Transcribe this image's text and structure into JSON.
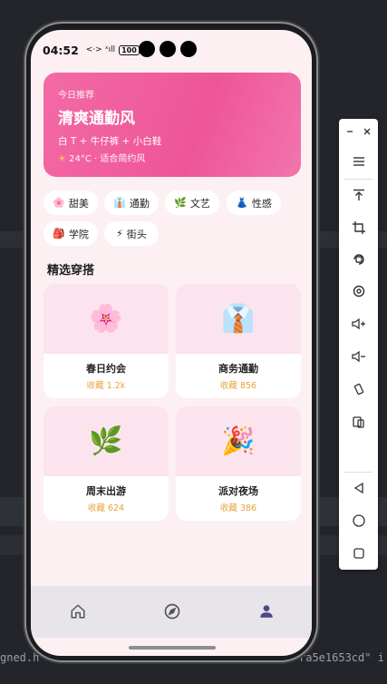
{
  "status_bar": {
    "time": "04:52",
    "indicators": "<·> ˣıll",
    "battery": "100"
  },
  "hero": {
    "kicker": "今日推荐",
    "title": "清爽通勤风",
    "outfit": "白 T + 牛仔裤 + 小白鞋",
    "weather_icon": "☀",
    "weather": "24°C · 适合简约风"
  },
  "chips": [
    {
      "icon": "🌸",
      "label": "甜美"
    },
    {
      "icon": "👔",
      "label": "通勤"
    },
    {
      "icon": "🌿",
      "label": "文艺"
    },
    {
      "icon": "👗",
      "label": "性感"
    },
    {
      "icon": "🎒",
      "label": "学院"
    },
    {
      "icon": "⚡",
      "label": "街头"
    }
  ],
  "section_title": "精选穿搭",
  "cards": [
    {
      "emoji": "🌸",
      "name": "春日约会",
      "favorites": "收藏 1.2k"
    },
    {
      "emoji": "👔",
      "name": "商务通勤",
      "favorites": "收藏 856"
    },
    {
      "emoji": "🌿",
      "name": "周末出游",
      "favorites": "收藏 624"
    },
    {
      "emoji": "🎉",
      "name": "派对夜场",
      "favorites": "收藏 386"
    }
  ],
  "tabs": [
    {
      "icon": "home-icon"
    },
    {
      "icon": "compass-icon"
    },
    {
      "icon": "profile-icon",
      "active": true
    }
  ],
  "colors": {
    "accent": "#ee5597",
    "tab_active": "#4a4a8a",
    "tab_inactive": "#555555",
    "favorites": "#e8a23a"
  },
  "background_code": {
    "left": "gned.h",
    "right": "ra5e1653cd\" i"
  },
  "emulator_toolbar": {
    "items": [
      "minimize-icon",
      "close-icon",
      "menu-icon",
      "pin-top-icon",
      "crop-icon",
      "rotate-icon",
      "screenshot-icon",
      "volume-up-icon",
      "volume-down-icon",
      "shake-icon",
      "multi-device-icon",
      "back-icon",
      "home-circle-icon",
      "overview-icon"
    ]
  }
}
